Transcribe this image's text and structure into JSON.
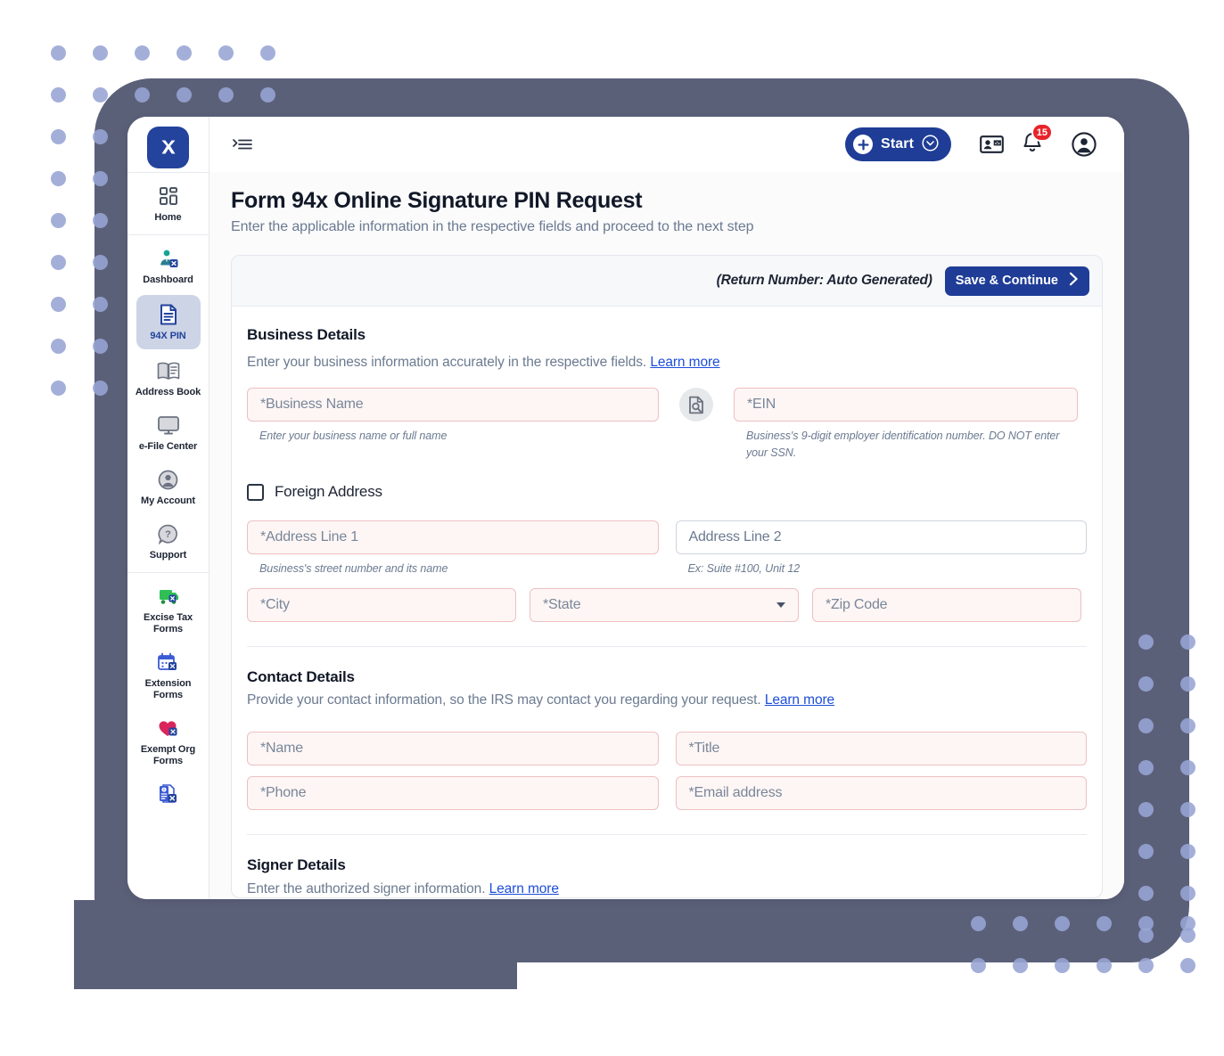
{
  "app": {
    "logo_glyph": "X"
  },
  "topbar": {
    "menu_icon": "hamburger-collapse-icon",
    "start_label": "Start",
    "contact_card_icon": "contact-card-icon",
    "bell_icon": "bell-icon",
    "notification_count": "15",
    "account_icon": "user-account-icon"
  },
  "sidebar": {
    "groups": [
      {
        "items": [
          {
            "label": "Home",
            "icon": "dashboard-grid-icon",
            "active": false
          }
        ]
      },
      {
        "items": [
          {
            "label": "Dashboard",
            "icon": "user-tax-icon",
            "active": false
          },
          {
            "label": "94X PIN",
            "icon": "document-icon",
            "active": true
          },
          {
            "label": "Address Book",
            "icon": "address-book-icon",
            "active": false
          },
          {
            "label": "e-File Center",
            "icon": "monitor-icon",
            "active": false
          },
          {
            "label": "My Account",
            "icon": "account-circle-icon",
            "active": false
          },
          {
            "label": "Support",
            "icon": "help-bubble-icon",
            "active": false
          }
        ]
      },
      {
        "items": [
          {
            "label": "Excise Tax Forms",
            "icon": "truck-icon",
            "active": false
          },
          {
            "label": "Extension Forms",
            "icon": "calendar-icon",
            "active": false
          },
          {
            "label": "Exempt Org Forms",
            "icon": "heart-icon",
            "active": false
          },
          {
            "label": "",
            "icon": "info-document-icon",
            "active": false
          }
        ]
      }
    ]
  },
  "page": {
    "title": "Form 94x Online Signature PIN Request",
    "subtitle": "Enter the applicable information in the respective fields and proceed to the next step"
  },
  "card": {
    "return_number": "(Return Number: Auto Generated)",
    "save_continue_label": "Save & Continue"
  },
  "business": {
    "section_title": "Business Details",
    "section_desc": "Enter your business information accurately in the respective fields.",
    "learn_more": "Learn more",
    "name_placeholder": "*Business Name",
    "name_hint": "Enter your business name or full name",
    "lookup_icon": "document-search-icon",
    "ein_placeholder": "*EIN",
    "ein_hint": "Business's 9-digit employer identification number. DO NOT enter your SSN.",
    "foreign_address_label": "Foreign Address",
    "address1_placeholder": "*Address Line 1",
    "address1_hint": "Business's street number and its name",
    "address2_placeholder": "Address Line 2",
    "address2_hint": "Ex: Suite #100, Unit 12",
    "city_placeholder": "*City",
    "state_placeholder": "*State",
    "zip_placeholder": "*Zip Code"
  },
  "contact": {
    "section_title": "Contact Details",
    "section_desc": "Provide your contact information, so the IRS may contact you regarding your request.",
    "learn_more": "Learn more",
    "name_placeholder": "*Name",
    "title_placeholder": "*Title",
    "phone_placeholder": "*Phone",
    "email_placeholder": "*Email address"
  },
  "signer": {
    "section_title": "Signer Details",
    "section_desc": "Enter the authorized signer information.",
    "learn_more": "Learn more"
  },
  "colors": {
    "brand_blue": "#1f3d96",
    "logo_blue": "#23439c",
    "badge_red": "#e8242a",
    "slab_gray": "#5b6079",
    "dot_periwinkle": "#97a4d4",
    "required_border": "#eec0c2",
    "required_bg": "#fdf6f5",
    "active_nav_bg": "#ccd4e6"
  }
}
